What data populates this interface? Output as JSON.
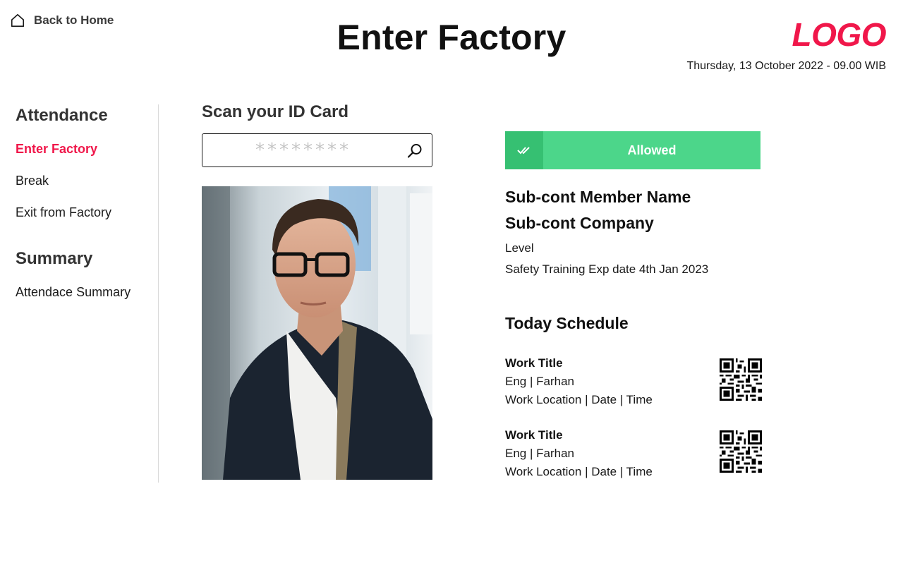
{
  "header": {
    "back_label": "Back to Home",
    "title": "Enter Factory",
    "logo": "LOGO",
    "datetime": "Thursday, 13 October 2022 - 09.00 WIB"
  },
  "sidebar": {
    "attendance_title": "Attendance",
    "attendance_items": [
      {
        "label": "Enter Factory",
        "active": true
      },
      {
        "label": "Break",
        "active": false
      },
      {
        "label": "Exit from Factory",
        "active": false
      }
    ],
    "summary_title": "Summary",
    "summary_items": [
      {
        "label": "Attendace Summary",
        "active": false
      }
    ]
  },
  "scan": {
    "title": "Scan your ID Card",
    "placeholder": "********",
    "search_icon": "search-icon"
  },
  "status": {
    "label": "Allowed",
    "icon": "double-check-icon",
    "color": "#4cd68a"
  },
  "member": {
    "name": "Sub-cont Member Name",
    "company": "Sub-cont Company",
    "level": "Level",
    "safety": "Safety Training Exp date 4th Jan 2023"
  },
  "schedule": {
    "title": "Today Schedule",
    "items": [
      {
        "title": "Work Title",
        "engineer": "Eng | Farhan",
        "details": "Work Location | Date | Time"
      },
      {
        "title": "Work Title",
        "engineer": "Eng | Farhan",
        "details": "Work Location | Date | Time"
      }
    ]
  },
  "colors": {
    "accent": "#f0174a",
    "status_green": "#4cd68a",
    "status_green_dark": "#36c072"
  }
}
